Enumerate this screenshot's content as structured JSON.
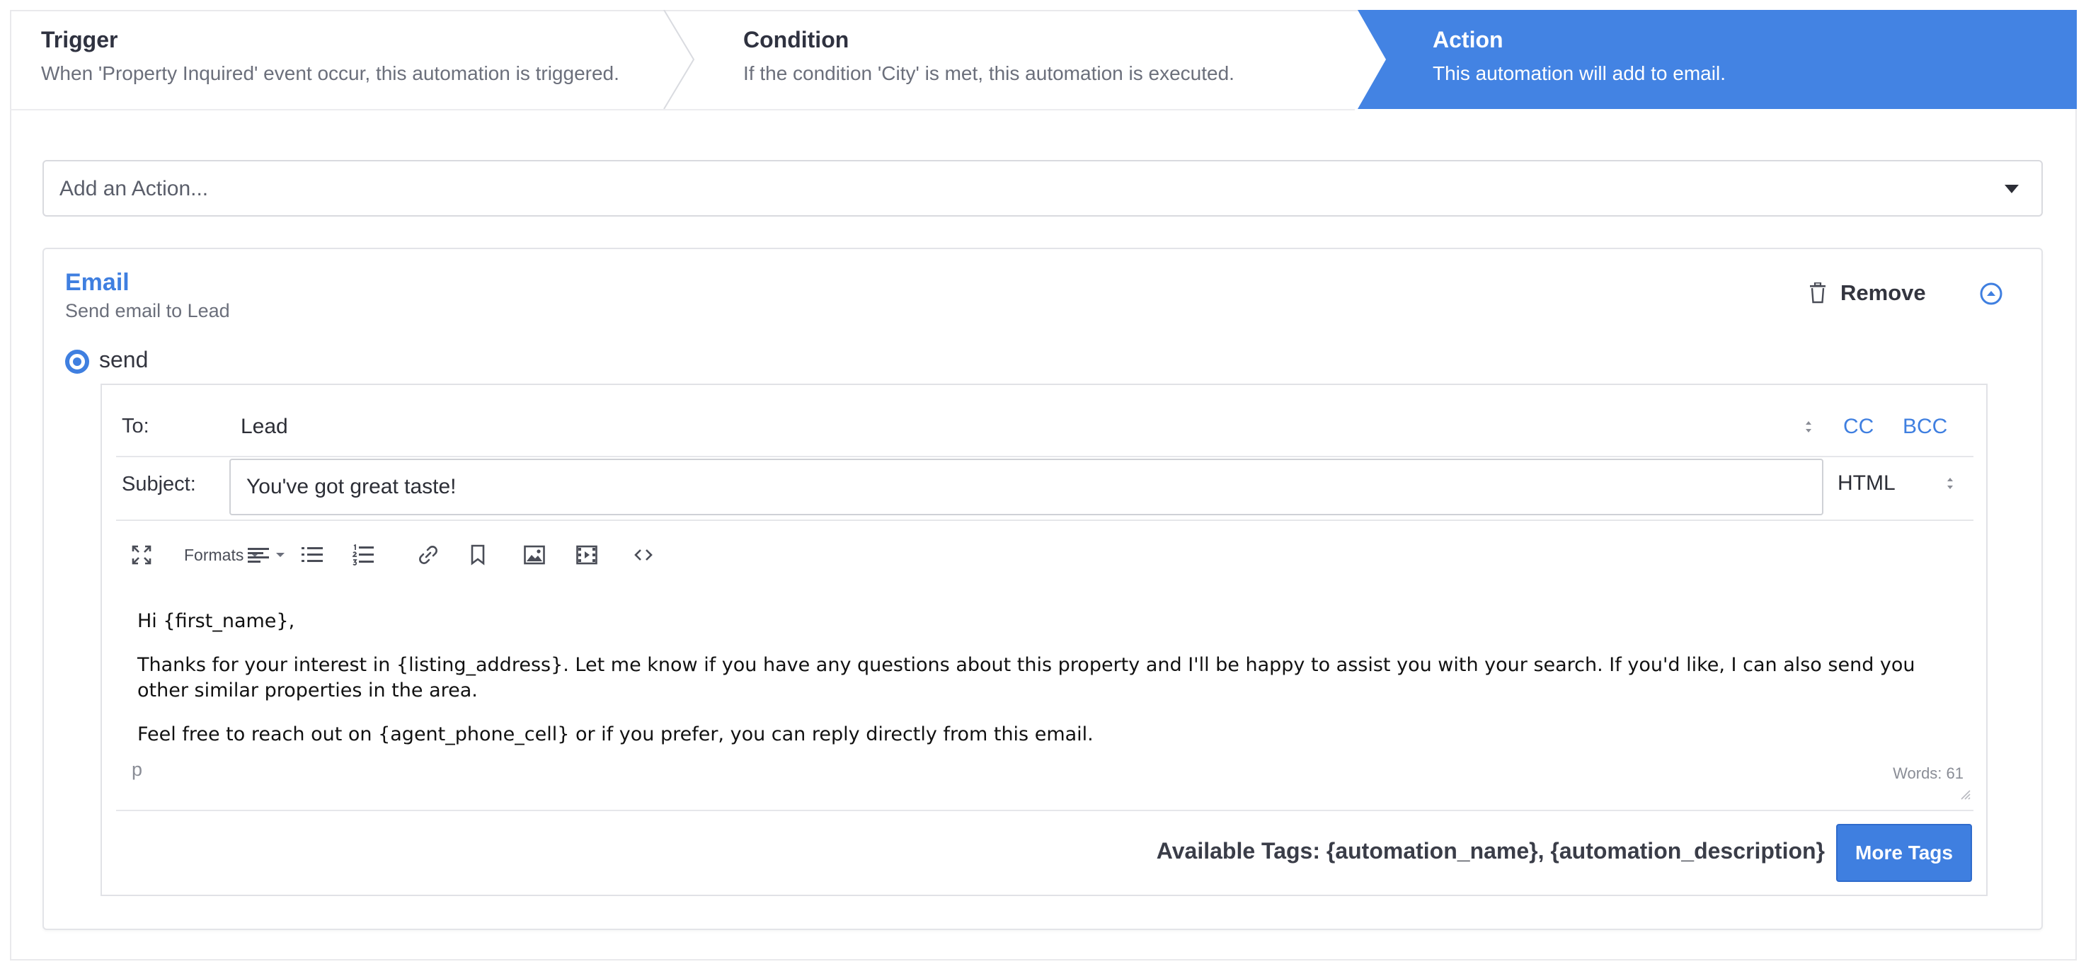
{
  "steps": [
    {
      "title": "Trigger",
      "description": "When 'Property Inquired' event occur, this automation is triggered."
    },
    {
      "title": "Condition",
      "description": "If the condition 'City' is met, this automation is executed."
    },
    {
      "title": "Action",
      "description": "This automation will add to email."
    }
  ],
  "action_select": {
    "placeholder": "Add an Action..."
  },
  "email_card": {
    "title": "Email",
    "subtitle": "Send email to Lead",
    "remove_label": "Remove",
    "send_label": "send"
  },
  "editor": {
    "to_label": "To:",
    "to_value": "Lead",
    "cc_label": "CC",
    "bcc_label": "BCC",
    "subject_label": "Subject:",
    "subject_value": "You've got great taste!",
    "format_value": "HTML",
    "toolbar": {
      "formats_label": "Formats"
    },
    "body": [
      "Hi {first_name},",
      "Thanks for your interest in {listing_address}. Let me know if you have any questions about this property and I'll be happy to assist you with your search. If you'd like, I can also send you other similar properties in the area.",
      "Feel free to reach out on {agent_phone_cell} or if you prefer, you can reply directly from this email."
    ],
    "path_indicator": "p",
    "word_count": "Words: 61",
    "available_tags": "Available Tags: {automation_name}, {automation_description}",
    "more_tags_label": "More Tags"
  },
  "colors": {
    "accent": "#3f7fe0",
    "step_active_bg": "#4383e3"
  },
  "icons": [
    "trash-icon",
    "collapse-up-icon",
    "fullscreen-icon",
    "align-left-icon",
    "bullet-list-icon",
    "numbered-list-icon",
    "link-icon",
    "bookmark-icon",
    "image-icon",
    "video-icon",
    "code-icon"
  ]
}
